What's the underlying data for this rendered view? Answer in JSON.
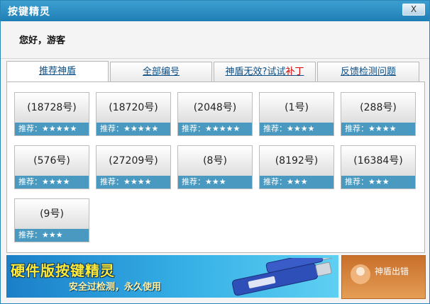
{
  "window": {
    "title": "按键精灵",
    "close_label": "X"
  },
  "greeting": "您好，游客",
  "tabs": [
    {
      "label": "推荐神盾",
      "active": true
    },
    {
      "label": "全部编号",
      "active": false
    },
    {
      "label": "神盾无效?试试",
      "highlight": "补丁",
      "active": false
    },
    {
      "label": "反馈检测问题",
      "active": false
    }
  ],
  "cards": [
    {
      "label": "(18728号)",
      "rating": "推荐：★★★★★"
    },
    {
      "label": "(18720号)",
      "rating": "推荐：★★★★★"
    },
    {
      "label": "(2048号)",
      "rating": "推荐：★★★★★"
    },
    {
      "label": "(1号)",
      "rating": "推荐：★★★★"
    },
    {
      "label": "(288号)",
      "rating": "推荐：★★★★"
    },
    {
      "label": "(576号)",
      "rating": "推荐：★★★★"
    },
    {
      "label": "(27209号)",
      "rating": "推荐：★★★★"
    },
    {
      "label": "(8号)",
      "rating": "推荐：★★★"
    },
    {
      "label": "(8192号)",
      "rating": "推荐：★★★"
    },
    {
      "label": "(16384号)",
      "rating": "推荐：★★★"
    },
    {
      "label": "(9号)",
      "rating": "推荐：★★★"
    }
  ],
  "banner": {
    "title": "硬件版按键精灵",
    "subtitle": "安全过检测，永久使用"
  },
  "ad": {
    "text": "神盾出错"
  },
  "colors": {
    "titlebar": "#2a86b6",
    "card_footer": "#4a99c1",
    "tab_link": "#0d4f86",
    "highlight": "#d40000"
  }
}
